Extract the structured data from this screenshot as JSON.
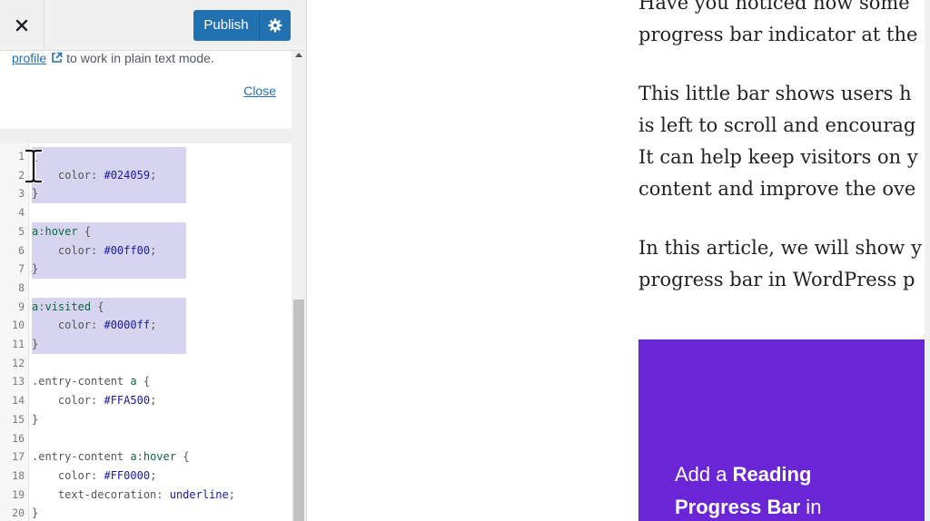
{
  "header": {
    "publish_label": "Publish"
  },
  "notice": {
    "link_text": "profile",
    "text": "to work in plain text mode.",
    "close_label": "Close"
  },
  "editor": {
    "lines": [
      {
        "n": "1",
        "t": "{"
      },
      {
        "n": "2",
        "t": "    color: #024059;"
      },
      {
        "n": "3",
        "t": "}"
      },
      {
        "n": "4",
        "t": ""
      },
      {
        "n": "5",
        "t": "a:hover {"
      },
      {
        "n": "6",
        "t": "    color: #00ff00;"
      },
      {
        "n": "7",
        "t": "}"
      },
      {
        "n": "8",
        "t": ""
      },
      {
        "n": "9",
        "t": "a:visited {"
      },
      {
        "n": "10",
        "t": "    color: #0000ff;"
      },
      {
        "n": "11",
        "t": "}"
      },
      {
        "n": "12",
        "t": ""
      },
      {
        "n": "13",
        "t": ".entry-content a {"
      },
      {
        "n": "14",
        "t": "    color: #FFA500;"
      },
      {
        "n": "15",
        "t": "}"
      },
      {
        "n": "16",
        "t": ""
      },
      {
        "n": "17",
        "t": ".entry-content a:hover {"
      },
      {
        "n": "18",
        "t": "    color: #FF0000;"
      },
      {
        "n": "19",
        "t": "    text-decoration: underline;"
      },
      {
        "n": "20",
        "t": "}"
      }
    ]
  },
  "preview": {
    "paragraphs": [
      "Have you noticed how some",
      "progress bar indicator at the",
      "This little bar shows users h",
      "is left to scroll and encourag",
      "It can help keep visitors on y",
      "content and improve the ove",
      "In this article, we will show y",
      "progress bar in WordPress p"
    ],
    "banner_line1_a": "Add a ",
    "banner_line1_b": "Reading",
    "banner_line2_a": "Progress Bar",
    "banner_line2_b": " in"
  },
  "colors": {
    "publish": "#2271b1",
    "banner": "#6a25d6",
    "selection": "#d7d4f0"
  }
}
